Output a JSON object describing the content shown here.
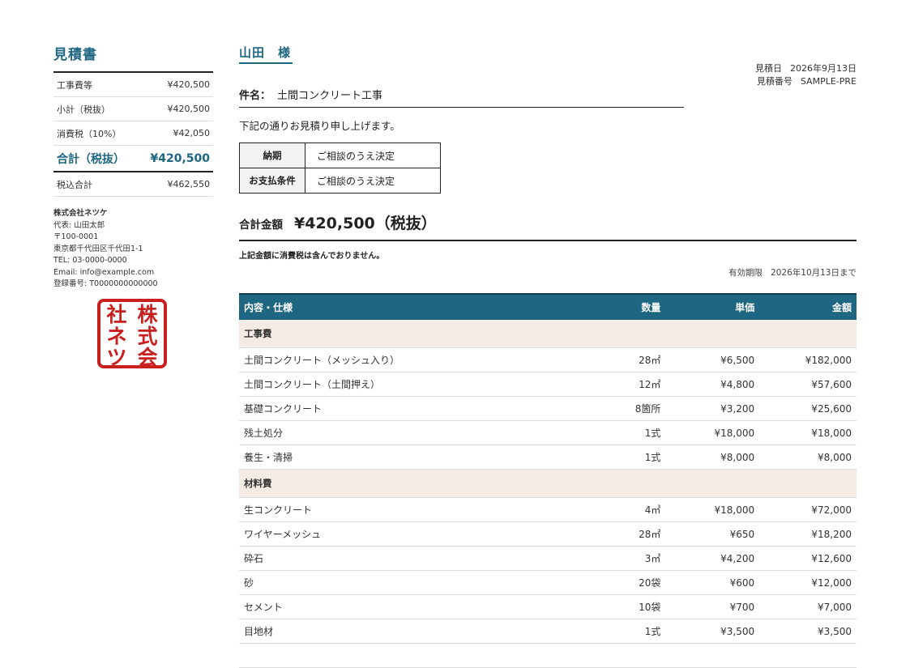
{
  "doc": {
    "title": "見積書"
  },
  "summary": {
    "rows": [
      {
        "label": "工事費等",
        "value": "¥420,500"
      },
      {
        "label": "小計（税抜）",
        "value": "¥420,500"
      },
      {
        "label": "消費税（10%）",
        "value": "¥42,050"
      }
    ],
    "total": {
      "label": "合計（税抜）",
      "value": "¥420,500"
    },
    "tax_incl": {
      "label": "税込合計",
      "value": "¥462,550"
    }
  },
  "company": {
    "name": "株式会社ネツケ",
    "rep": "代表: 山田太郎",
    "postal": "〒100-0001",
    "address": "東京都千代田区千代田1-1",
    "tel": "TEL: 03-0000-0000",
    "email": "Email: info@example.com",
    "reg": "登録番号: T0000000000000",
    "seal_text": "株式会社ネツケ"
  },
  "client": {
    "name": "山田　様"
  },
  "meta": {
    "date_label": "見積日",
    "date_value": "2026年9月13日",
    "no_label": "見積番号",
    "no_value": "SAMPLE-PRE"
  },
  "subject": {
    "label": "件名：",
    "value": "土間コンクリート工事"
  },
  "greeting": "下記の通りお見積り申し上げます。",
  "terms": [
    {
      "label": "納期",
      "value": "ご相談のうえ決定"
    },
    {
      "label": "お支払条件",
      "value": "ご相談のうえ決定"
    }
  ],
  "grand": {
    "label": "合計金額",
    "amount": "¥420,500（税抜）"
  },
  "tax_note": "上記金額に消費税は含んでおりません。",
  "validity": {
    "label": "有効期限",
    "value": "2026年10月13日まで"
  },
  "table": {
    "headers": {
      "name": "内容・仕様",
      "qty": "数量",
      "unit": "単価",
      "amount": "金額"
    },
    "groups": [
      {
        "category": "工事費",
        "rows": [
          {
            "name": "土間コンクリート（メッシュ入り）",
            "qty": "28㎡",
            "unit": "¥6,500",
            "amount": "¥182,000"
          },
          {
            "name": "土間コンクリート（土間押え）",
            "qty": "12㎡",
            "unit": "¥4,800",
            "amount": "¥57,600"
          },
          {
            "name": "基礎コンクリート",
            "qty": "8箇所",
            "unit": "¥3,200",
            "amount": "¥25,600"
          },
          {
            "name": "残土処分",
            "qty": "1式",
            "unit": "¥18,000",
            "amount": "¥18,000"
          },
          {
            "name": "養生・清掃",
            "qty": "1式",
            "unit": "¥8,000",
            "amount": "¥8,000"
          }
        ]
      },
      {
        "category": "材料費",
        "rows": [
          {
            "name": "生コンクリート",
            "qty": "4㎥",
            "unit": "¥18,000",
            "amount": "¥72,000"
          },
          {
            "name": "ワイヤーメッシュ",
            "qty": "28㎡",
            "unit": "¥650",
            "amount": "¥18,200"
          },
          {
            "name": "砕石",
            "qty": "3㎥",
            "unit": "¥4,200",
            "amount": "¥12,600"
          },
          {
            "name": "砂",
            "qty": "20袋",
            "unit": "¥600",
            "amount": "¥12,000"
          },
          {
            "name": "セメント",
            "qty": "10袋",
            "unit": "¥700",
            "amount": "¥7,000"
          },
          {
            "name": "目地材",
            "qty": "1式",
            "unit": "¥3,500",
            "amount": "¥3,500"
          }
        ]
      }
    ]
  },
  "colors": {
    "accent": "#1e6682",
    "category_bg": "#f4ebe5",
    "seal": "#c8201e"
  }
}
